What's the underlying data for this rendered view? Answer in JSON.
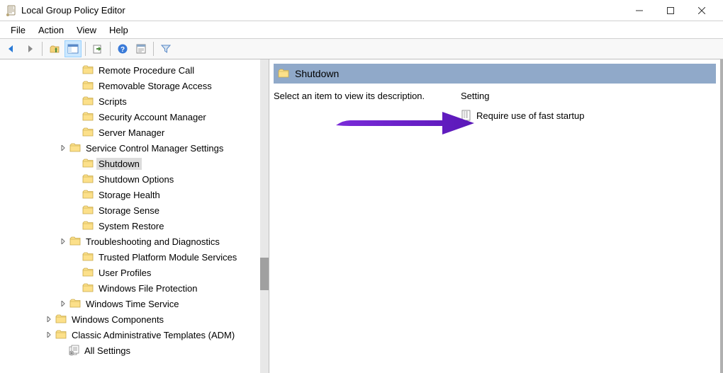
{
  "window": {
    "title": "Local Group Policy Editor"
  },
  "menu": {
    "file": "File",
    "action": "Action",
    "view": "View",
    "help": "Help"
  },
  "tree": {
    "items": [
      {
        "indent": 100,
        "expand": "",
        "label": "Remote Procedure Call"
      },
      {
        "indent": 100,
        "expand": "",
        "label": "Removable Storage Access"
      },
      {
        "indent": 100,
        "expand": "",
        "label": "Scripts"
      },
      {
        "indent": 100,
        "expand": "",
        "label": "Security Account Manager"
      },
      {
        "indent": 100,
        "expand": "",
        "label": "Server Manager"
      },
      {
        "indent": 82,
        "expand": ">",
        "label": "Service Control Manager Settings"
      },
      {
        "indent": 100,
        "expand": "",
        "label": "Shutdown",
        "selected": true
      },
      {
        "indent": 100,
        "expand": "",
        "label": "Shutdown Options"
      },
      {
        "indent": 100,
        "expand": "",
        "label": "Storage Health"
      },
      {
        "indent": 100,
        "expand": "",
        "label": "Storage Sense"
      },
      {
        "indent": 100,
        "expand": "",
        "label": "System Restore"
      },
      {
        "indent": 82,
        "expand": ">",
        "label": "Troubleshooting and Diagnostics"
      },
      {
        "indent": 100,
        "expand": "",
        "label": "Trusted Platform Module Services"
      },
      {
        "indent": 100,
        "expand": "",
        "label": "User Profiles"
      },
      {
        "indent": 100,
        "expand": "",
        "label": "Windows File Protection"
      },
      {
        "indent": 82,
        "expand": ">",
        "label": "Windows Time Service"
      },
      {
        "indent": 62,
        "expand": ">",
        "label": "Windows Components"
      },
      {
        "indent": 62,
        "expand": ">",
        "label": "Classic Administrative Templates (ADM)"
      },
      {
        "indent": 80,
        "expand": "",
        "label": "All Settings",
        "icon": "settings"
      }
    ]
  },
  "details": {
    "header_title": "Shutdown",
    "desc_prompt": "Select an item to view its description.",
    "setting_header": "Setting",
    "settings": [
      {
        "label": "Require use of fast startup"
      }
    ]
  }
}
